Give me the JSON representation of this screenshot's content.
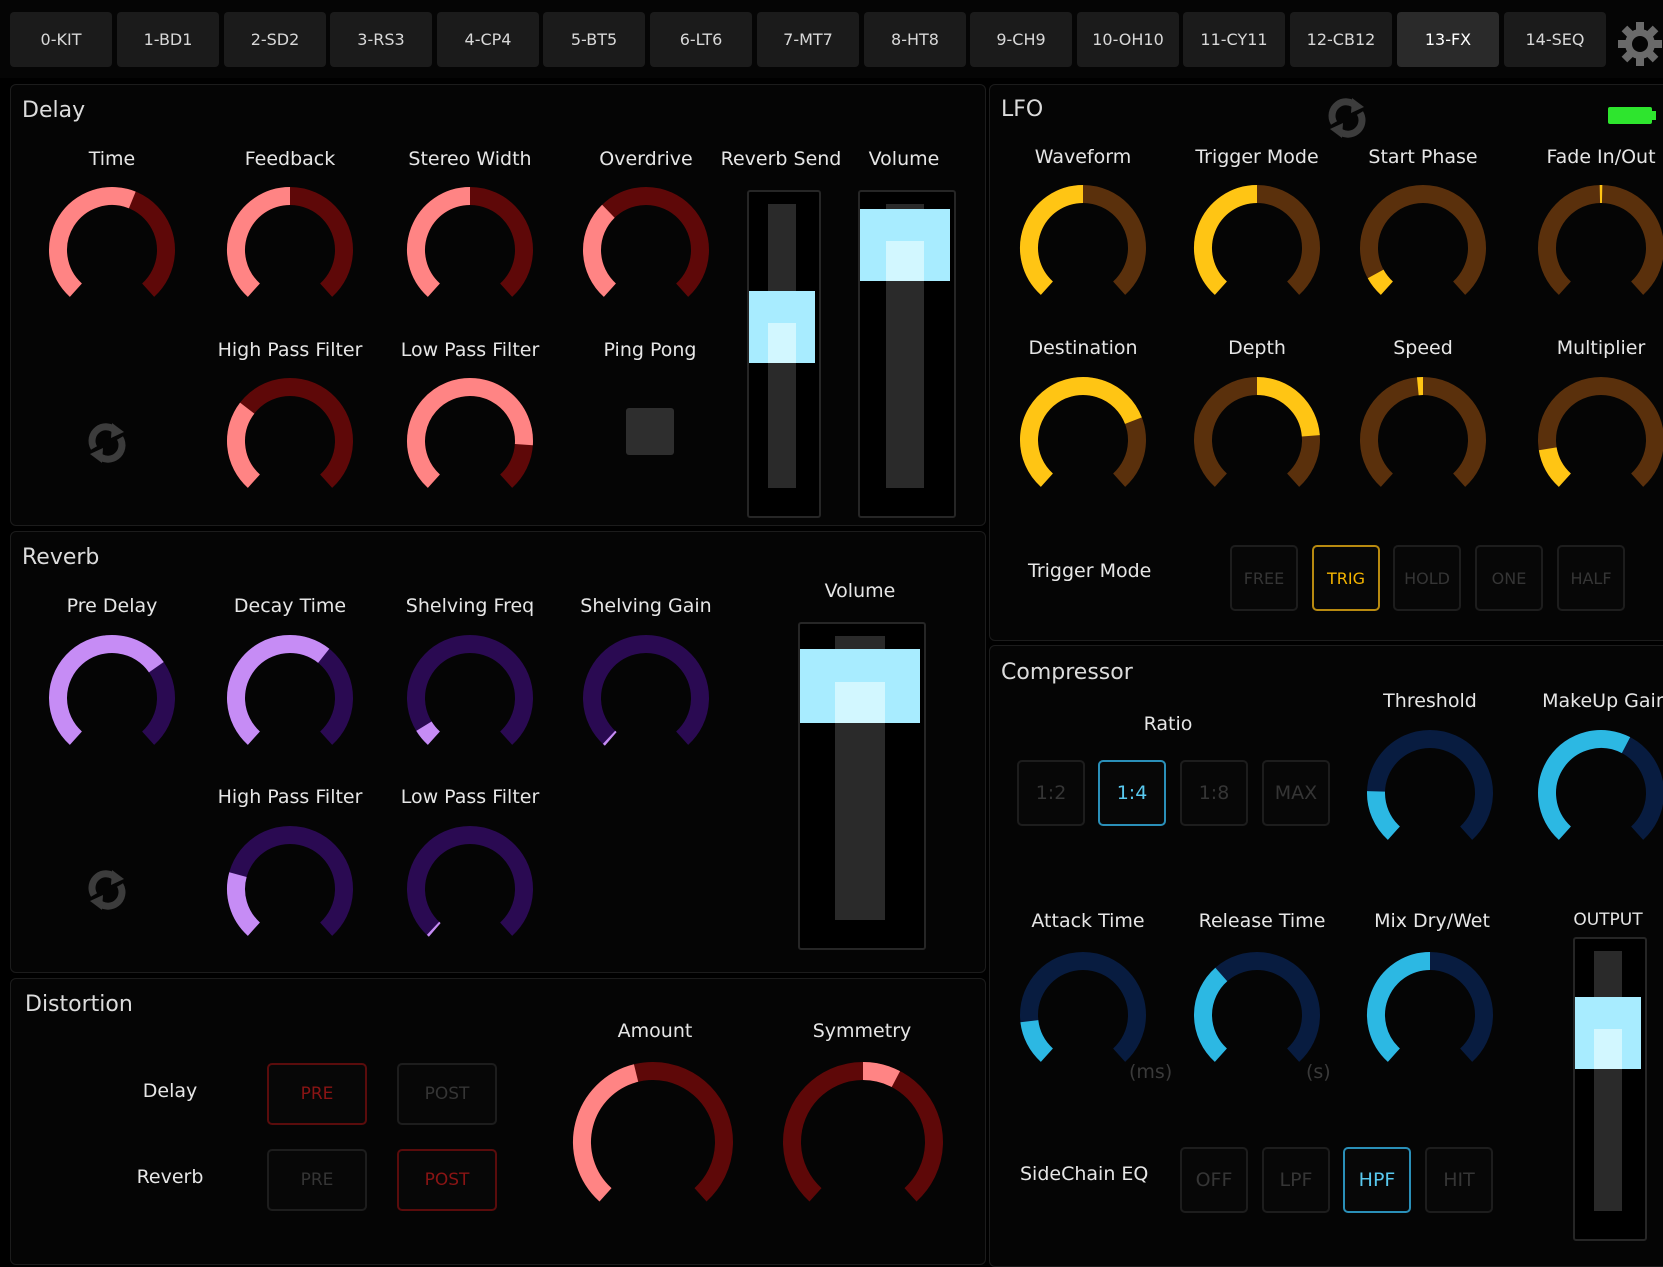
{
  "tabs": [
    {
      "label": "0-KIT"
    },
    {
      "label": "1-BD1"
    },
    {
      "label": "2-SD2"
    },
    {
      "label": "3-RS3"
    },
    {
      "label": "4-CP4"
    },
    {
      "label": "5-BT5"
    },
    {
      "label": "6-LT6"
    },
    {
      "label": "7-MT7"
    },
    {
      "label": "8-HT8"
    },
    {
      "label": "9-CH9"
    },
    {
      "label": "10-OH10"
    },
    {
      "label": "11-CY11"
    },
    {
      "label": "12-CB12"
    },
    {
      "label": "13-FX"
    },
    {
      "label": "14-SEQ"
    }
  ],
  "active_tab": "13-FX",
  "settings_icon": "gear-icon",
  "colors": {
    "delay_active": "#ff8484",
    "delay_track": "#5e0808",
    "reverb_active": "#c68cf5",
    "reverb_track": "#2a0a52",
    "lfo_active": "#ffc514",
    "lfo_track": "#5a300c",
    "comp_active": "#2cb8e3",
    "comp_track": "#081c40",
    "slider_handle": "#a8ecff"
  },
  "delay": {
    "title": "Delay",
    "knobs": [
      {
        "label": "Time",
        "value": 0.58
      },
      {
        "label": "Feedback",
        "value": 0.5
      },
      {
        "label": "Stereo Width",
        "value": 0.5
      },
      {
        "label": "Overdrive",
        "value": 0.34
      },
      {
        "label": "High Pass Filter",
        "value": 0.31
      },
      {
        "label": "Low Pass Filter",
        "value": 0.84
      }
    ],
    "ping_pong_label": "Ping Pong",
    "ping_pong_on": false,
    "reverb_send": {
      "label": "Reverb Send",
      "value": 0.6
    },
    "volume": {
      "label": "Volume",
      "value": 0.93
    }
  },
  "reverb": {
    "title": "Reverb",
    "knobs": [
      {
        "label": "Pre Delay",
        "value": 0.7
      },
      {
        "label": "Decay Time",
        "value": 0.64
      },
      {
        "label": "Shelving Freq",
        "value": 0.06
      },
      {
        "label": "Shelving Gain",
        "value": 0.0
      },
      {
        "label": "High Pass Filter",
        "value": 0.23
      },
      {
        "label": "Low Pass Filter",
        "value": 0.0
      }
    ],
    "volume": {
      "label": "Volume",
      "value": 0.9
    }
  },
  "distortion": {
    "title": "Distortion",
    "rows": [
      {
        "label": "Delay",
        "pre": "PRE",
        "post": "POST",
        "selected": "PRE"
      },
      {
        "label": "Reverb",
        "pre": "PRE",
        "post": "POST",
        "selected": "POST"
      }
    ],
    "amount": {
      "label": "Amount",
      "value": 0.45
    },
    "symmetry": {
      "label": "Symmetry",
      "value": 0.6,
      "bipolar": true
    }
  },
  "lfo": {
    "title": "LFO",
    "battery_color": "#2ee52e",
    "knobs": [
      {
        "label": "Waveform",
        "value": 0.5
      },
      {
        "label": "Trigger Mode",
        "value": 0.5
      },
      {
        "label": "Start Phase",
        "value": 0.07
      },
      {
        "label": "Fade In/Out",
        "value": 0.5,
        "bipolar": true
      },
      {
        "label": "Destination",
        "value": 0.75
      },
      {
        "label": "Depth",
        "value": 0.81,
        "bipolar": true
      },
      {
        "label": "Speed",
        "value": 0.48,
        "bipolar": true
      },
      {
        "label": "Multiplier",
        "value": 0.14
      }
    ],
    "trigger_mode_label": "Trigger Mode",
    "trigger_modes": [
      "FREE",
      "TRIG",
      "HOLD",
      "ONE",
      "HALF"
    ],
    "trigger_selected": "TRIG"
  },
  "compressor": {
    "title": "Compressor",
    "ratio_label": "Ratio",
    "ratios": [
      "1:2",
      "1:4",
      "1:8",
      "MAX"
    ],
    "ratio_selected": "1:4",
    "threshold": {
      "label": "Threshold",
      "value": 0.18
    },
    "makeup": {
      "label": "MakeUp Gain",
      "value": 0.6
    },
    "attack": {
      "label": "Attack Time",
      "value": 0.15,
      "unit": "(ms)"
    },
    "release": {
      "label": "Release Time",
      "value": 0.35,
      "unit": "(s)"
    },
    "mix": {
      "label": "Mix Dry/Wet",
      "value": 0.5
    },
    "output": {
      "label": "OUTPUT",
      "value": 0.74
    },
    "sidechain_label": "SideChain EQ",
    "sidechain_options": [
      "OFF",
      "LPF",
      "HPF",
      "HIT"
    ],
    "sidechain_selected": "HPF"
  }
}
